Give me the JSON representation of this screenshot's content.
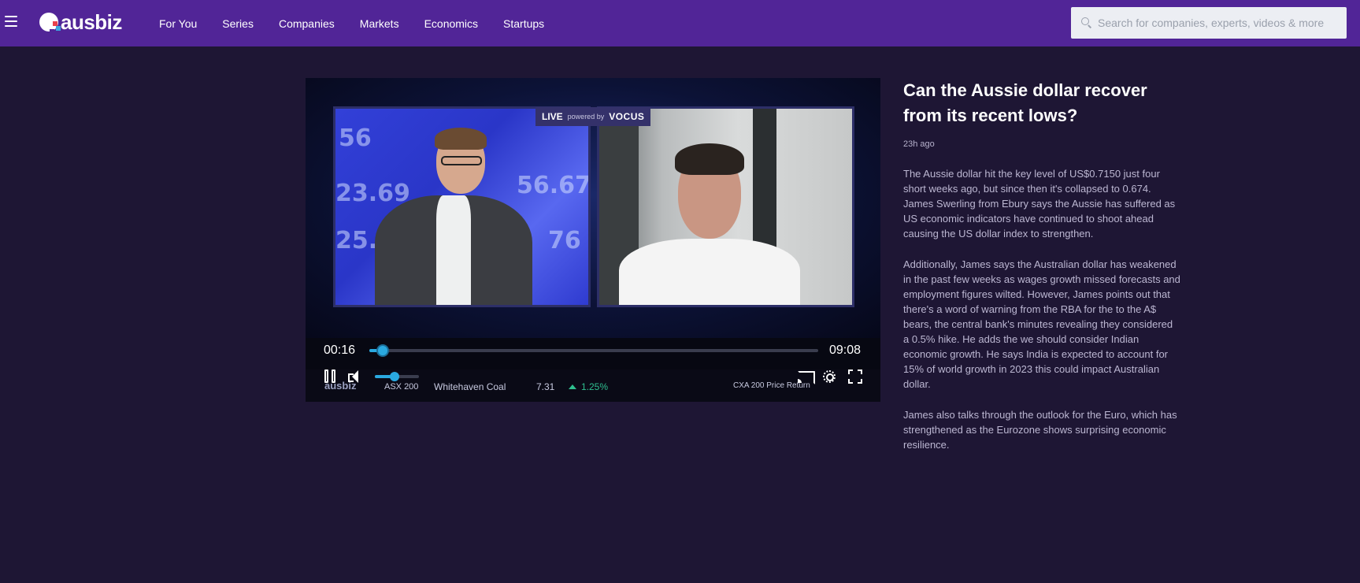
{
  "header": {
    "logo_text": "ausbiz",
    "nav": [
      "For You",
      "Series",
      "Companies",
      "Markets",
      "Economics",
      "Startups"
    ],
    "search_placeholder": "Search for companies, experts, videos & more"
  },
  "player": {
    "live_label": "LIVE",
    "powered_by": "powered by",
    "sponsor": "VOCUS",
    "current_time": "00:16",
    "total_time": "09:08",
    "progress_fraction": 0.029,
    "volume_fraction": 0.45,
    "studio_numbers": [
      "56",
      "23.69",
      "56.67",
      "25.84",
      "76"
    ],
    "lower_third": {
      "brand": "ausbiz",
      "index": "ASX 200",
      "company": "Whitehaven Coal",
      "price": "7.31",
      "change": "1.25%",
      "right_label": "CXA 200 Price Return"
    },
    "icons": [
      "pause-icon",
      "volume-icon",
      "cast-icon",
      "settings-icon",
      "fullscreen-icon"
    ]
  },
  "article": {
    "title": "Can the Aussie dollar recover from its recent lows?",
    "timestamp": "23h ago",
    "paragraphs": [
      "The Aussie dollar hit the key level of US$0.7150 just four short weeks ago, but since then it's collapsed to 0.674. James Swerling from Ebury says the Aussie has suffered as US economic indicators have continued to shoot ahead causing the US dollar index to strengthen.",
      "Additionally, James says the Australian dollar has weakened in the past few weeks as wages growth missed forecasts and employment figures wilted. However, James points out that there's a word of warning from the RBA for the to the A$ bears, the central bank's minutes revealing they considered a 0.5% hike. He adds the we should consider Indian economic growth. He says India is expected to account for 15% of world growth in 2023 this could impact Australian dollar.",
      "James also talks through the outlook for the Euro, which has strengthened as the Eurozone shows surprising economic resilience."
    ]
  },
  "colors": {
    "header_bg": "#512597",
    "page_bg": "#1e1634",
    "accent": "#2aa9e0",
    "positive": "#2fbf8f"
  }
}
